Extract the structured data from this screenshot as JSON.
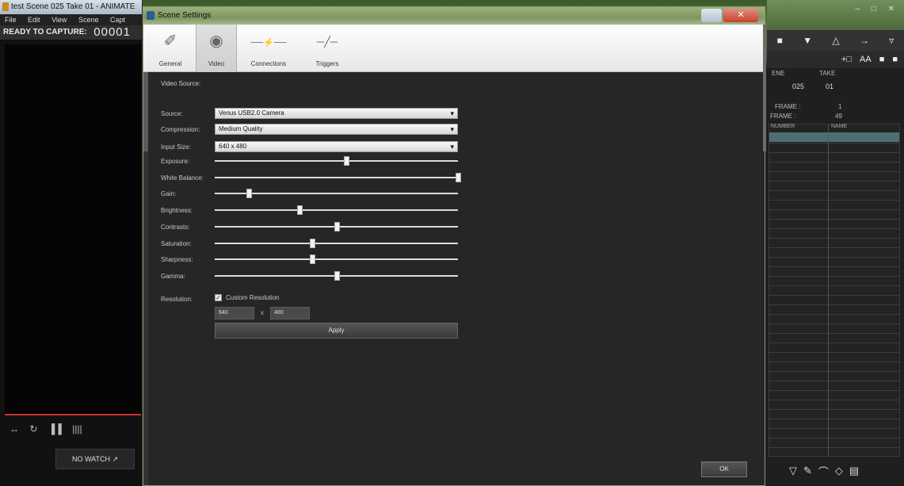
{
  "main_window": {
    "title": "test Scene 025 Take 01 - ANIMATE",
    "menu": [
      "File",
      "Edit",
      "View",
      "Scene",
      "Capt"
    ],
    "capture_label": "READY TO CAPTURE:",
    "frame_counter": "00001",
    "toolbar_glyphs": [
      "↔",
      "↻",
      "▐▐",
      "||||"
    ],
    "no_watch_label": "NO WATCH ↗"
  },
  "right_panel": {
    "window_buttons": "– □ ✕",
    "tools": [
      "■",
      "▼",
      "△",
      "→",
      "▿"
    ],
    "tools2": [
      "+□",
      "AA",
      "■",
      "■"
    ],
    "scene_header": [
      "ENE",
      "TAKE"
    ],
    "scene_values": [
      "025",
      "01"
    ],
    "frame_label": "FRAME :",
    "frame_value": "1",
    "frame2_label": "FRAME :",
    "frame2_value": "49",
    "sheet_cols": [
      "NUMBER",
      "NAME"
    ],
    "bottom_tools": [
      "▽",
      "✎",
      "⌒",
      "◇",
      "▤"
    ]
  },
  "dialog": {
    "title": "Scene Settings",
    "tabs": [
      {
        "label": "General",
        "icon": "✐",
        "active": false
      },
      {
        "label": "Video",
        "icon": "◉",
        "active": true
      },
      {
        "label": "Connections",
        "icon": "──⚡──",
        "active": false
      },
      {
        "label": "Triggers",
        "icon": "─╱─",
        "active": false
      }
    ],
    "section_title": "Video Source:",
    "source_label": "Source:",
    "source_value": "Venus USB2.0 Camera",
    "compression_label": "Compression:",
    "compression_value": "Medium Quality",
    "input_size_label": "Input Size:",
    "input_size_value": "640 x 480",
    "sliders": [
      {
        "label": "Exposure:",
        "value": 0.54
      },
      {
        "label": "White Balance:",
        "value": 1.0
      },
      {
        "label": "Gain:",
        "value": 0.14
      },
      {
        "label": "Brightness:",
        "value": 0.35
      },
      {
        "label": "Contrasts:",
        "value": 0.5
      },
      {
        "label": "Saturation:",
        "value": 0.4
      },
      {
        "label": "Sharpness:",
        "value": 0.4
      },
      {
        "label": "Gamma:",
        "value": 0.5
      }
    ],
    "resolution_label": "Resolution:",
    "custom_resolution_label": "Custom Resolution",
    "custom_resolution_checked": true,
    "res_width": "640",
    "res_height": "480",
    "res_separator": "x",
    "apply_label": "Apply",
    "ok_label": "OK"
  }
}
